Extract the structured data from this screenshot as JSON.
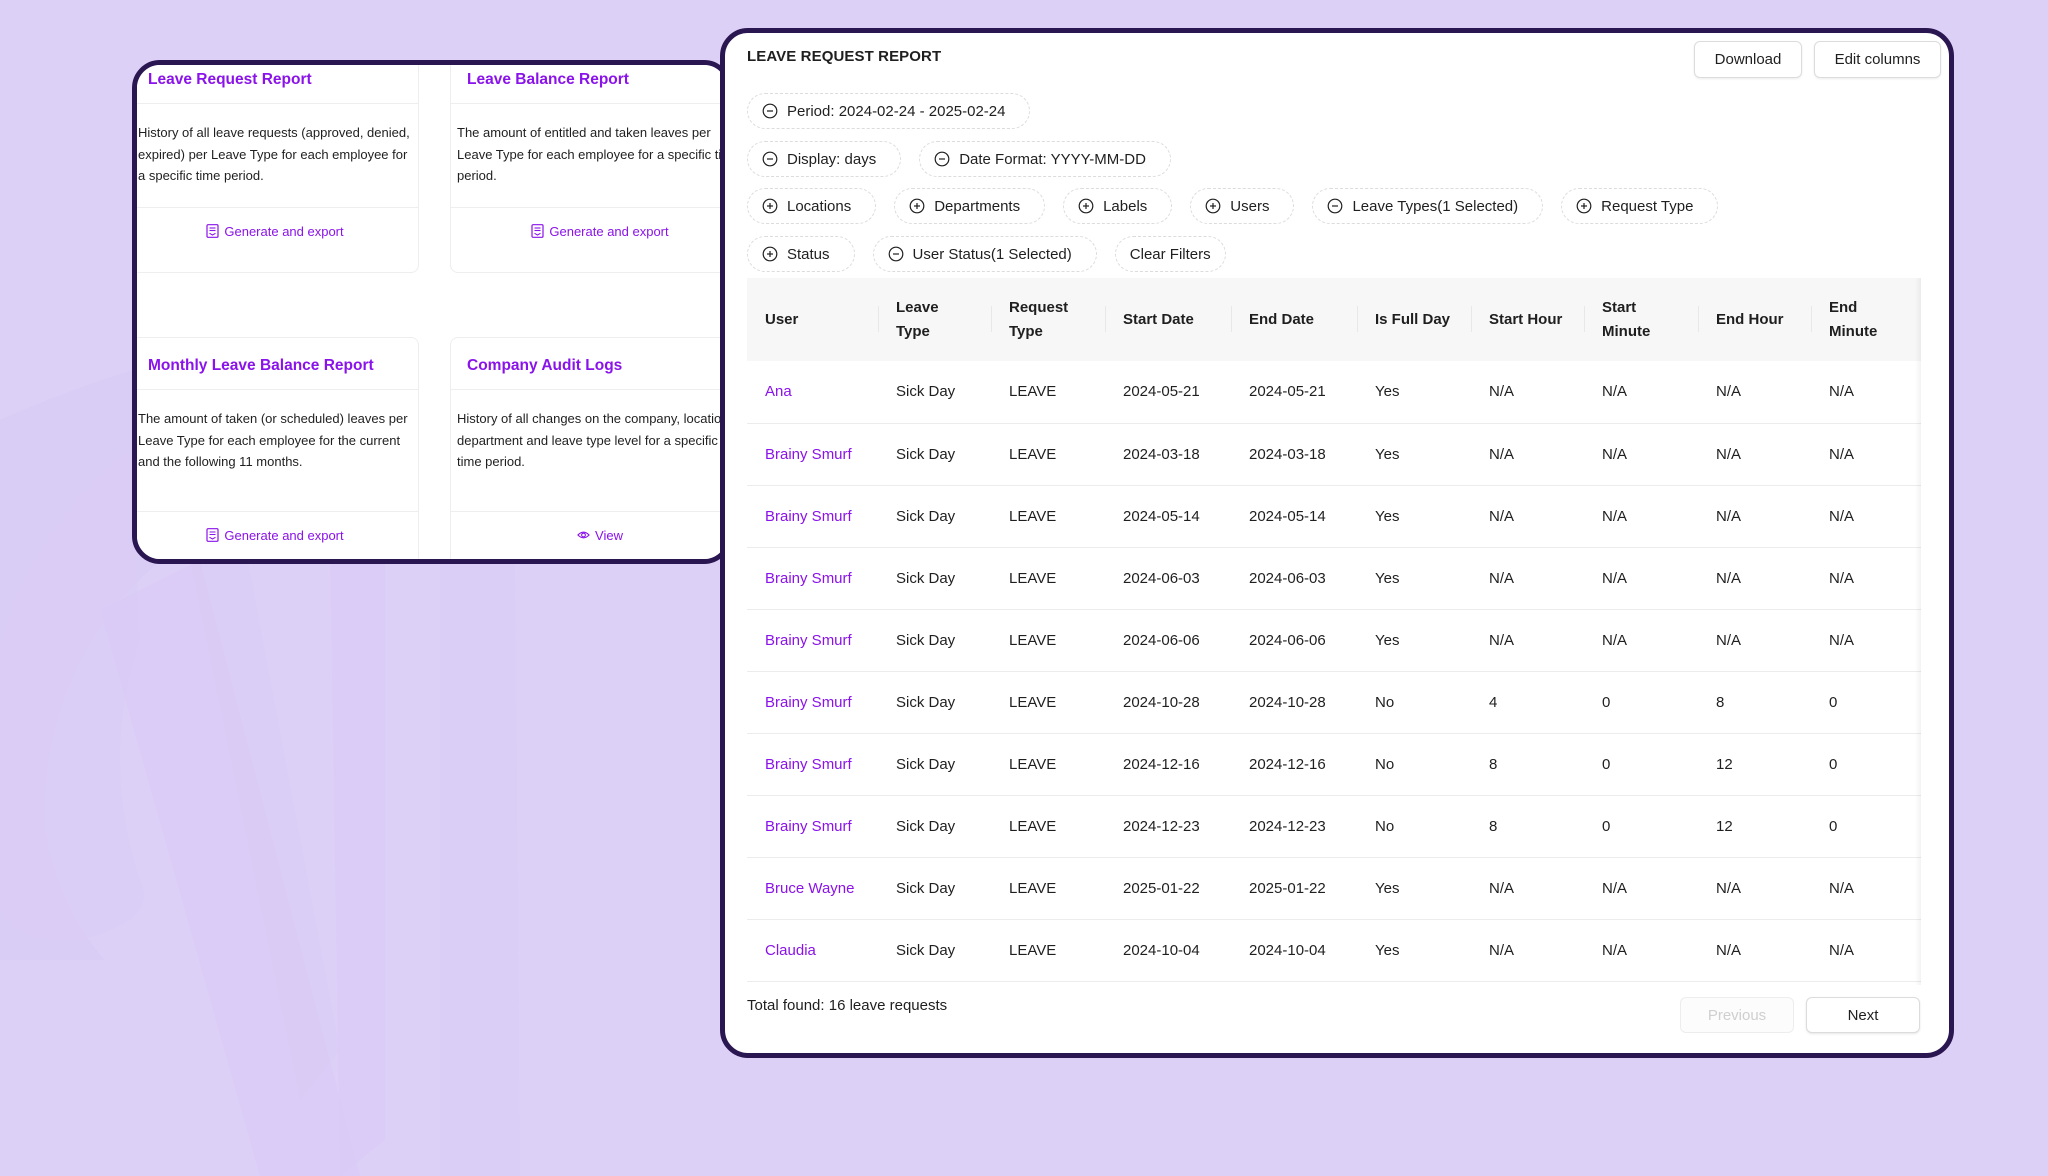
{
  "colors": {
    "background": "#ddd0f7",
    "panel_border": "#2a1650",
    "accent_purple": "#8a12ea",
    "text": "#1f1f1f"
  },
  "report_cards": [
    {
      "title": "Leave Request Report",
      "description": "History of all leave requests (approved, denied, expired) per Leave Type for each employee for a specific time period.",
      "action_label": "Generate and export",
      "action_icon": "report-document-icon"
    },
    {
      "title": "Leave Balance Report",
      "description": "The amount of entitled and taken leaves per Leave Type for each employee for a specific time period.",
      "action_label": "Generate and export",
      "action_icon": "report-document-icon"
    },
    {
      "title": "Monthly Leave Balance Report",
      "description": "The amount of taken (or scheduled) leaves per Leave Type for each employee for the current and the following 11 months.",
      "action_label": "Generate and export",
      "action_icon": "report-document-icon"
    },
    {
      "title": "Company Audit Logs",
      "description": "History of all changes on the company, location, department and leave type level for a specific time period.",
      "action_label": "View",
      "action_icon": "eye-icon"
    }
  ],
  "report": {
    "title": "LEAVE REQUEST REPORT",
    "download_label": "Download",
    "edit_columns_label": "Edit columns",
    "filters": [
      [
        {
          "label": "Period: 2024-02-24 - 2025-02-24",
          "icon": "minus-circle-icon"
        }
      ],
      [
        {
          "label": "Display: days",
          "icon": "minus-circle-icon"
        },
        {
          "label": "Date Format: YYYY-MM-DD",
          "icon": "minus-circle-icon"
        }
      ],
      [
        {
          "label": "Locations",
          "icon": "plus-circle-icon"
        },
        {
          "label": "Departments",
          "icon": "plus-circle-icon"
        },
        {
          "label": "Labels",
          "icon": "plus-circle-icon"
        },
        {
          "label": "Users",
          "icon": "plus-circle-icon"
        },
        {
          "label": "Leave Types(1 Selected)",
          "icon": "minus-circle-icon"
        },
        {
          "label": "Request Type",
          "icon": "plus-circle-icon"
        }
      ],
      [
        {
          "label": "Status",
          "icon": "plus-circle-icon"
        },
        {
          "label": "User Status(1 Selected)",
          "icon": "minus-circle-icon"
        },
        {
          "label": "Clear Filters",
          "icon": ""
        }
      ]
    ],
    "columns": [
      "User",
      "Leave Type",
      "Request Type",
      "Start Date",
      "End Date",
      "Is Full Day",
      "Start Hour",
      "Start Minute",
      "End Hour",
      "End Minute"
    ],
    "rows": [
      [
        "Ana",
        "Sick Day",
        "LEAVE",
        "2024-05-21",
        "2024-05-21",
        "Yes",
        "N/A",
        "N/A",
        "N/A",
        "N/A"
      ],
      [
        "Brainy Smurf",
        "Sick Day",
        "LEAVE",
        "2024-03-18",
        "2024-03-18",
        "Yes",
        "N/A",
        "N/A",
        "N/A",
        "N/A"
      ],
      [
        "Brainy Smurf",
        "Sick Day",
        "LEAVE",
        "2024-05-14",
        "2024-05-14",
        "Yes",
        "N/A",
        "N/A",
        "N/A",
        "N/A"
      ],
      [
        "Brainy Smurf",
        "Sick Day",
        "LEAVE",
        "2024-06-03",
        "2024-06-03",
        "Yes",
        "N/A",
        "N/A",
        "N/A",
        "N/A"
      ],
      [
        "Brainy Smurf",
        "Sick Day",
        "LEAVE",
        "2024-06-06",
        "2024-06-06",
        "Yes",
        "N/A",
        "N/A",
        "N/A",
        "N/A"
      ],
      [
        "Brainy Smurf",
        "Sick Day",
        "LEAVE",
        "2024-10-28",
        "2024-10-28",
        "No",
        "4",
        "0",
        "8",
        "0"
      ],
      [
        "Brainy Smurf",
        "Sick Day",
        "LEAVE",
        "2024-12-16",
        "2024-12-16",
        "No",
        "8",
        "0",
        "12",
        "0"
      ],
      [
        "Brainy Smurf",
        "Sick Day",
        "LEAVE",
        "2024-12-23",
        "2024-12-23",
        "No",
        "8",
        "0",
        "12",
        "0"
      ],
      [
        "Bruce Wayne",
        "Sick Day",
        "LEAVE",
        "2025-01-22",
        "2025-01-22",
        "Yes",
        "N/A",
        "N/A",
        "N/A",
        "N/A"
      ],
      [
        "Claudia",
        "Sick Day",
        "LEAVE",
        "2024-10-04",
        "2024-10-04",
        "Yes",
        "N/A",
        "N/A",
        "N/A",
        "N/A"
      ]
    ],
    "total_label": "Total found: 16 leave requests",
    "previous_label": "Previous",
    "next_label": "Next"
  }
}
